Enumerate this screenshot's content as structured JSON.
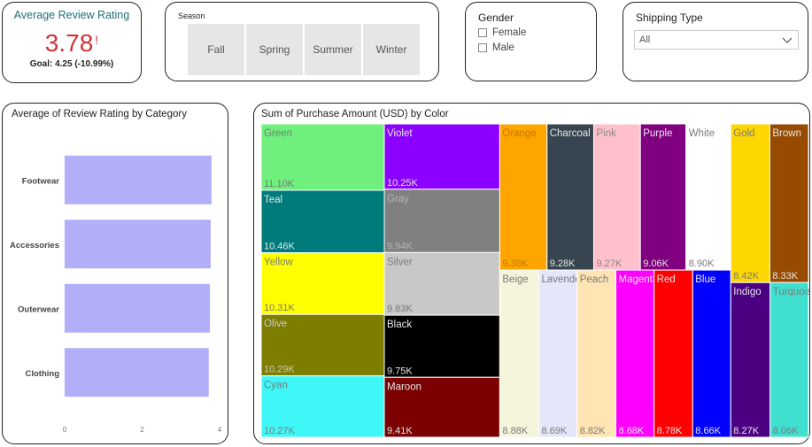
{
  "kpi": {
    "title": "Average Review Rating",
    "value": "3.78",
    "alert": "!",
    "goal": "Goal: 4.25 (-10.99%)",
    "value_color": "#d13438"
  },
  "season_slicer": {
    "title": "Season",
    "options": [
      "Fall",
      "Spring",
      "Summer",
      "Winter"
    ]
  },
  "gender_slicer": {
    "title": "Gender",
    "options": [
      "Female",
      "Male"
    ]
  },
  "shipping_slicer": {
    "title": "Shipping Type",
    "selected": "All",
    "icon": "chevron-down-icon"
  },
  "chart_data": [
    {
      "type": "bar",
      "orientation": "horizontal",
      "title": "Average of Review Rating by Category",
      "categories": [
        "Footwear",
        "Accessories",
        "Outerwear",
        "Clothing"
      ],
      "values": [
        3.79,
        3.77,
        3.75,
        3.72
      ],
      "xlim": [
        0,
        4
      ],
      "xticks": [
        "0",
        "2",
        "4"
      ],
      "bar_color": "#b3aef8",
      "grid": false
    },
    {
      "type": "treemap",
      "title": "Sum of Purchase Amount (USD) by Color",
      "items": [
        {
          "name": "Green",
          "label": "11.10K",
          "value": 11100,
          "color": "#6ff07d",
          "text": "#7a7a7a"
        },
        {
          "name": "Teal",
          "label": "10.46K",
          "value": 10460,
          "color": "#007b7b",
          "text": "#e6e6e6"
        },
        {
          "name": "Yellow",
          "label": "10.31K",
          "value": 10310,
          "color": "#ffff00",
          "text": "#7a7a7a"
        },
        {
          "name": "Olive",
          "label": "10.29K",
          "value": 10290,
          "color": "#7d7d00",
          "text": "#c9c9c9"
        },
        {
          "name": "Cyan",
          "label": "10.27K",
          "value": 10270,
          "color": "#40f7f7",
          "text": "#7a7a7a"
        },
        {
          "name": "Violet",
          "label": "10.25K",
          "value": 10250,
          "color": "#8b00ff",
          "text": "#e6e6e6"
        },
        {
          "name": "Gray",
          "label": "9.94K",
          "value": 9940,
          "color": "#808080",
          "text": "#b4b4b4"
        },
        {
          "name": "Silver",
          "label": "9.83K",
          "value": 9830,
          "color": "#c8c8c8",
          "text": "#7a7a7a"
        },
        {
          "name": "Black",
          "label": "9.75K",
          "value": 9750,
          "color": "#000000",
          "text": "#e6e6e6"
        },
        {
          "name": "Maroon",
          "label": "9.41K",
          "value": 9410,
          "color": "#7b0000",
          "text": "#e6e6e6"
        },
        {
          "name": "Orange",
          "label": "9.38K",
          "value": 9380,
          "color": "#ffa500",
          "text": "#c07800"
        },
        {
          "name": "Charcoal",
          "label": "9.28K",
          "value": 9280,
          "color": "#36454f",
          "text": "#e6e6e6"
        },
        {
          "name": "Pink",
          "label": "9.27K",
          "value": 9270,
          "color": "#ffc0cb",
          "text": "#8a8a8a"
        },
        {
          "name": "Purple",
          "label": "9.06K",
          "value": 9060,
          "color": "#800080",
          "text": "#e6e6e6"
        },
        {
          "name": "White",
          "label": "8.90K",
          "value": 8900,
          "color": "#ffffff",
          "text": "#7a7a7a"
        },
        {
          "name": "Beige",
          "label": "8.88K",
          "value": 8880,
          "color": "#f5f5dc",
          "text": "#7a7a7a"
        },
        {
          "name": "Lavender",
          "label": "8.69K",
          "value": 8690,
          "color": "#e6e6fa",
          "text": "#7a7a7a"
        },
        {
          "name": "Peach",
          "label": "8.82K",
          "value": 8820,
          "color": "#ffe5b4",
          "text": "#7a7a7a"
        },
        {
          "name": "Magenta",
          "label": "8.68K",
          "value": 8680,
          "color": "#ff00ff",
          "text": "#e6e6e6"
        },
        {
          "name": "Red",
          "label": "8.78K",
          "value": 8780,
          "color": "#ff0000",
          "text": "#e6e6e6"
        },
        {
          "name": "Blue",
          "label": "8.66K",
          "value": 8660,
          "color": "#0000ff",
          "text": "#e6e6e6"
        },
        {
          "name": "Gold",
          "label": "8.42K",
          "value": 8420,
          "color": "#ffd700",
          "text": "#7a7a7a"
        },
        {
          "name": "Brown",
          "label": "8.33K",
          "value": 8330,
          "color": "#964b00",
          "text": "#e6e6e6"
        },
        {
          "name": "Indigo",
          "label": "8.27K",
          "value": 8270,
          "color": "#4b0082",
          "text": "#e6e6e6"
        },
        {
          "name": "Turquoise",
          "label": "8.06K",
          "value": 8060,
          "color": "#40e0d0",
          "text": "#7a7a7a"
        }
      ]
    }
  ]
}
